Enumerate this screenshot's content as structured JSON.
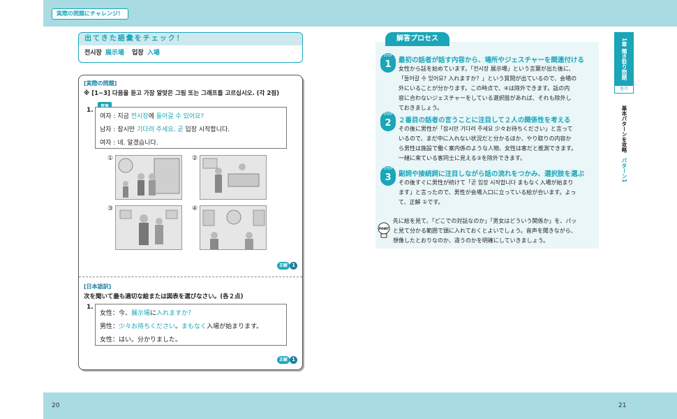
{
  "header": {
    "tab_label": "実際の問題にチャレンジ！"
  },
  "vocab": {
    "title": "出てきた語彙をチェック！",
    "items": [
      {
        "ko": "전시장",
        "ja": "展示場"
      },
      {
        "ko": "입장",
        "ja": "入場"
      }
    ]
  },
  "question": {
    "section_label": "[実際の問題]",
    "instruction": "※ [1~3] 다음을 듣고 가장 알맞은 그림 또는 그래프를 고르십시오. (각 2점)",
    "audio_tag": "音声",
    "number": "1.",
    "dialog": [
      {
        "speaker": "여자 : ",
        "pre": "지금 ",
        "h1": "전시장",
        "mid": "에 ",
        "h2": "들어갈 수 있어요?",
        "post": ""
      },
      {
        "speaker": "남자 : ",
        "pre": "잠시만 ",
        "h1": "기다려 주세요",
        "mid": ". ",
        "h2": "곧",
        "post": " 입장 시작합니다."
      },
      {
        "speaker": "여자 : ",
        "pre": "네. 알겠습니다.",
        "h1": "",
        "mid": "",
        "h2": "",
        "post": ""
      }
    ],
    "options": [
      "①",
      "②",
      "③",
      "④"
    ],
    "answer_label": "正解",
    "answer_value": "1"
  },
  "translation": {
    "section_label": "[日本語訳]",
    "instruction": "次を聞いて最も適切な絵または図表を選びなさい。(各２点)",
    "number": "1.",
    "dialog": [
      {
        "speaker": "女性：",
        "pre": "今、",
        "h1": "展示場",
        "mid": "に",
        "h2": "入れますか？",
        "post": ""
      },
      {
        "speaker": "男性：",
        "pre": "",
        "h1": "少々お待ちください",
        "mid": "。",
        "h2": "まもなく",
        "post": "入場が始まります。"
      },
      {
        "speaker": "女性：",
        "pre": "はい。分かりました。",
        "h1": "",
        "mid": "",
        "h2": "",
        "post": ""
      }
    ],
    "answer_label": "正解",
    "answer_value": "1"
  },
  "process": {
    "title": "解答プロセス",
    "step_label": "STEP",
    "steps": [
      {
        "num": "1",
        "title": "最初の話者が話す内容から、場所やジェスチャーを関連付ける",
        "lines": [
          "女性から話を始めています。「전시장 展示場」という言葉が出た後に、",
          "「들어갈 수 있어요? 入れますか？」という質問が出ているので、会場の",
          "外にいることが分かります。この時点で、④は除外できます。話の内",
          "容に合わないジェスチャーをしている選択肢があれば、それも除外し",
          "ておきましょう。"
        ]
      },
      {
        "num": "2",
        "title": "２番目の話者の言うことに注目して２人の関係性を考える",
        "lines": [
          "その後に男性が「잠시만 기다려 주세요 少々お待ちください」と言って",
          "いるので、まだ中に入れない状況だと分かるほか、やり取りの内容か",
          "ら男性は施設で働く案内係のような人物、女性は客だと推測できます。",
          "一緒に来ている客同士に見える③を除外できます。"
        ]
      },
      {
        "num": "3",
        "title": "副詞や接続詞に注目しながら話の流れをつかみ、選択肢を選ぶ",
        "lines": [
          "その後すぐに男性が続けて「곧 입장 시작합니다 まもなく入場が始まり",
          "ます」と言ったので、男性が会場入口に立っている絵が合います。よっ",
          "て、正解 ①です。"
        ]
      }
    ],
    "point_label": "POINT",
    "point_lines": [
      "先に絵を見て、「どこでの対話なのか」「男女はどういう関係か」を、パッ",
      "と見て分かる範囲で頭に入れておくとよいでしょう。音声を聞きながら、",
      "想像したとおりなのか、違うのかを明確にしていきましょう。"
    ]
  },
  "sidebar": {
    "chapter": "1章 聞き取り問題",
    "kor": "듣기",
    "text_main": "基本パターンを攻略",
    "text_pattern": "パターン1"
  },
  "pages": {
    "left": "20",
    "right": "21"
  }
}
